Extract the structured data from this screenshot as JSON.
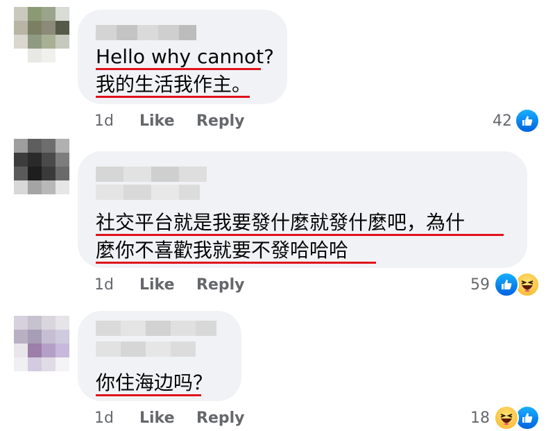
{
  "comments": [
    {
      "lines": [
        "Hello why cannot?",
        "我的生活我作主。"
      ],
      "time": "1d",
      "like_label": "Like",
      "reply_label": "Reply",
      "reaction_count": "42",
      "reactions": [
        "like-icon"
      ]
    },
    {
      "lines": [
        "社交平台就是我要發什麼就發什麼吧，為什",
        "麼你不喜歡我就要不發哈哈哈"
      ],
      "time": "1d",
      "like_label": "Like",
      "reply_label": "Reply",
      "reaction_count": "59",
      "reactions": [
        "like-icon",
        "haha-icon"
      ]
    },
    {
      "lines": [
        "你住海边吗？"
      ],
      "time": "1d",
      "like_label": "Like",
      "reply_label": "Reply",
      "reaction_count": "18",
      "reactions": [
        "haha-icon",
        "like-icon"
      ]
    }
  ],
  "colors": {
    "bubble": "#f0f2f5",
    "underline": "#e0101a",
    "meta": "#65676b",
    "like": "#1877f2"
  }
}
